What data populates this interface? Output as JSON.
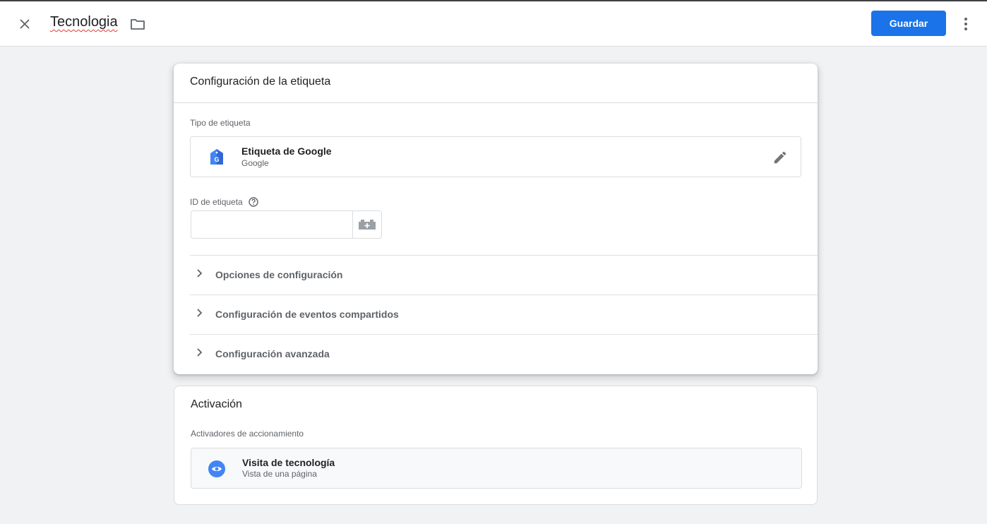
{
  "header": {
    "title": "Tecnologia",
    "save_label": "Guardar"
  },
  "config_card": {
    "title": "Configuración de la etiqueta",
    "tag_type_label": "Tipo de etiqueta",
    "tag_type": {
      "name": "Etiqueta de Google",
      "vendor": "Google",
      "icon": "google-tag-icon"
    },
    "tag_id_label": "ID de etiqueta",
    "tag_id_value": "",
    "sections": [
      {
        "label": "Opciones de configuración"
      },
      {
        "label": "Configuración de eventos compartidos"
      },
      {
        "label": "Configuración avanzada"
      }
    ]
  },
  "trigger_card": {
    "title": "Activación",
    "triggers_label": "Activadores de accionamiento",
    "trigger": {
      "name": "Visita de tecnología",
      "type": "Vista de una página",
      "icon": "eye-icon"
    }
  },
  "colors": {
    "accent": "#1a73e8",
    "background": "#f1f2f3",
    "tag_icon": "#4285f4"
  }
}
